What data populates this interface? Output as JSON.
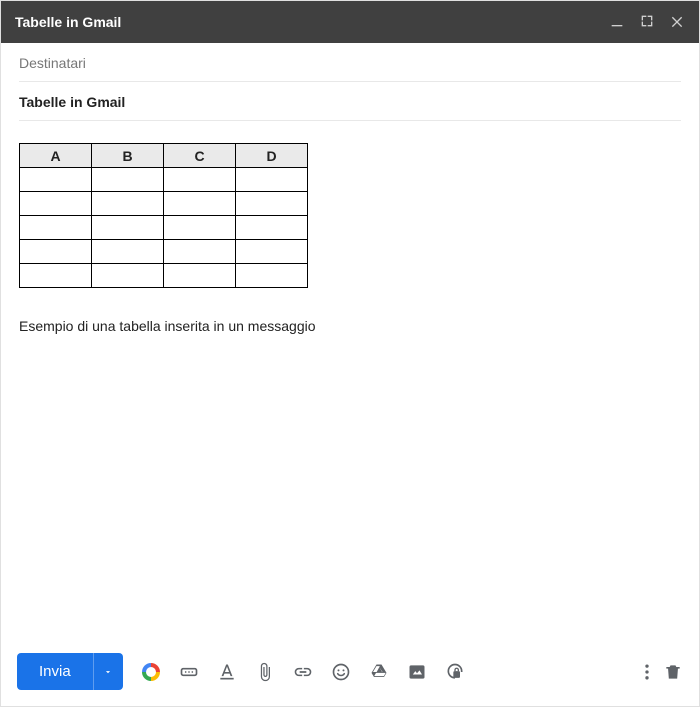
{
  "titlebar": {
    "title": "Tabelle in Gmail"
  },
  "fields": {
    "recipients_placeholder": "Destinatari",
    "subject": "Tabelle in Gmail"
  },
  "body": {
    "table_headers": [
      "A",
      "B",
      "C",
      "D"
    ],
    "table_rows": 5,
    "caption": "Esempio di una tabella inserita in un messaggio"
  },
  "toolbar": {
    "send_label": "Invia"
  }
}
